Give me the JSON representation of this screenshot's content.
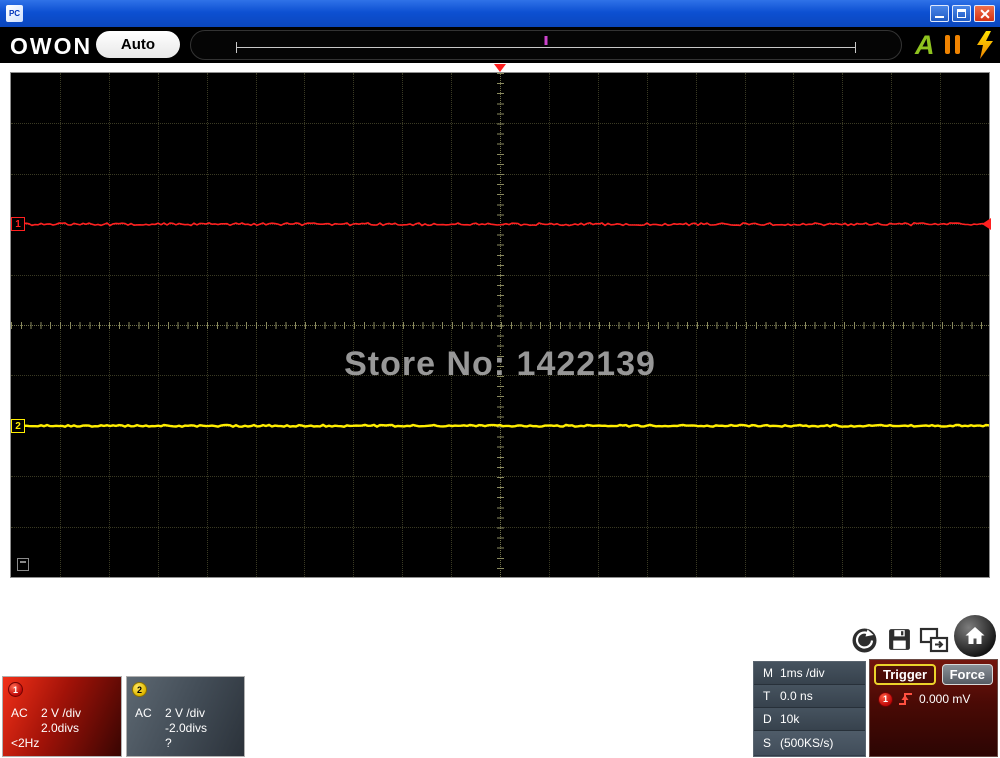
{
  "titlebar": {
    "app_icon_label": "PC"
  },
  "toolbar": {
    "brand": "OWON",
    "auto_button": "Auto",
    "acquire_indicator": "A",
    "icons": [
      "pause-icon",
      "flash-icon"
    ]
  },
  "scope": {
    "watermark": "Store No: 1422139",
    "grid": {
      "h_divs": 20,
      "v_divs": 10
    },
    "traces": [
      {
        "channel": "1",
        "color": "#ff2020",
        "position_divs": 2.0,
        "noise": 2.6,
        "width": 1.6
      },
      {
        "channel": "2",
        "color": "#ffee00",
        "position_divs": -2.0,
        "noise": 1.8,
        "width": 2.4
      }
    ],
    "trigger_marker_color": "#ff2020"
  },
  "acquisition": {
    "rows": [
      {
        "label": "M",
        "value": "1ms /div"
      },
      {
        "label": "T",
        "value": "0.0 ns"
      },
      {
        "label": "D",
        "value": "10k"
      },
      {
        "label": "S",
        "value": "(500KS/s)"
      }
    ]
  },
  "trigger": {
    "title": "Trigger",
    "force_button": "Force",
    "source_channel": "1",
    "slope": "rising",
    "level": "0.000 mV"
  },
  "channels": [
    {
      "number": "1",
      "coupling": "AC",
      "scale": "2 V /div",
      "position": "2.0divs",
      "frequency": "<2Hz"
    },
    {
      "number": "2",
      "coupling": "AC",
      "scale": "2 V /div",
      "position": "-2.0divs",
      "frequency": "?"
    }
  ],
  "icons": {
    "quickbar": [
      "capture-icon",
      "save-icon",
      "export-icon",
      "home-icon"
    ]
  }
}
